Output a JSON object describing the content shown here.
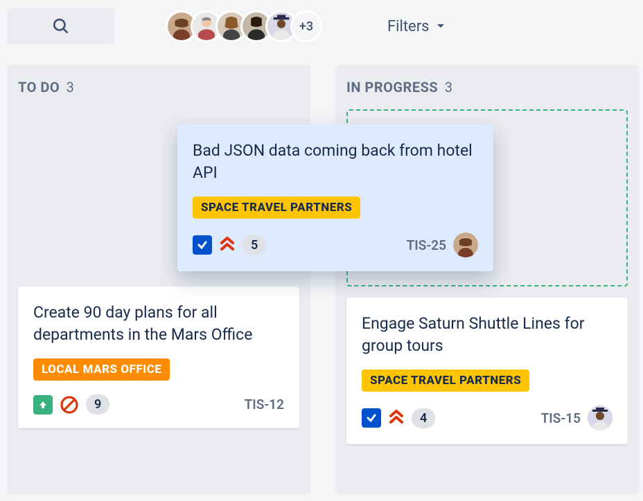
{
  "topbar": {
    "avatar_overflow": "+3",
    "filters_label": "Filters"
  },
  "columns": {
    "todo": {
      "label": "TO DO",
      "count": "3"
    },
    "in_progress": {
      "label": "IN PROGRESS",
      "count": "3"
    }
  },
  "cards": {
    "dragging": {
      "title": "Bad JSON data coming back from hotel API",
      "tag": "SPACE TRAVEL PARTNERS",
      "points": "5",
      "id": "TIS-25"
    },
    "todo_1": {
      "title": "Create 90 day plans for all departments in the Mars Office",
      "tag": "LOCAL MARS OFFICE",
      "points": "9",
      "id": "TIS-12"
    },
    "inprog_1": {
      "title": "Engage Saturn Shuttle Lines for group tours",
      "tag": "SPACE TRAVEL PARTNERS",
      "points": "4",
      "id": "TIS-15"
    }
  }
}
